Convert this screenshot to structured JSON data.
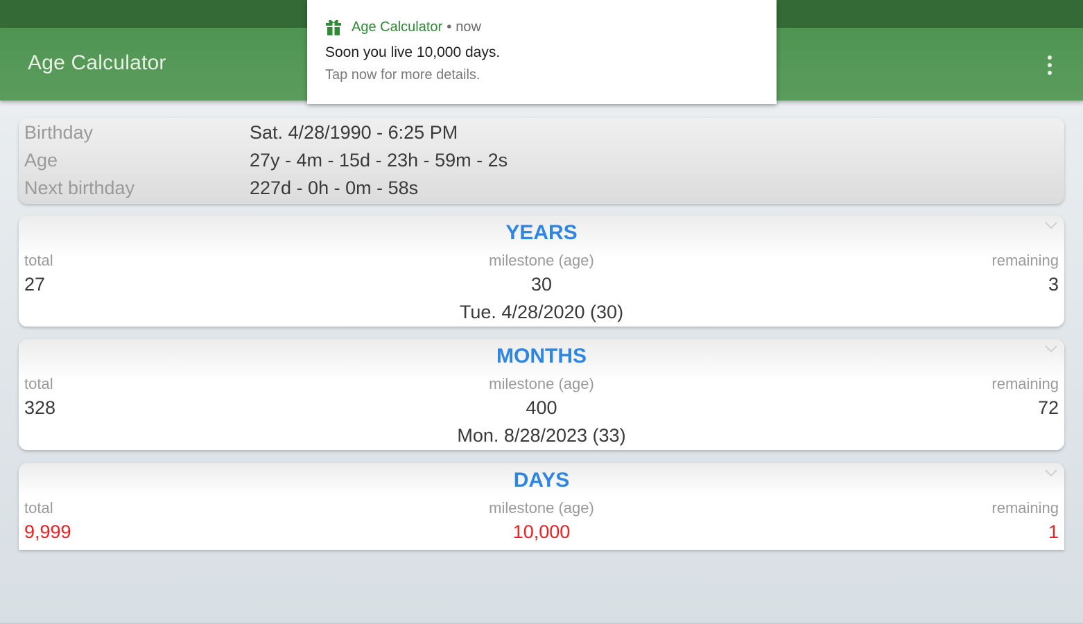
{
  "notification": {
    "app_name": "Age Calculator",
    "separator": "•",
    "time": "now",
    "title": "Soon you live 10,000 days.",
    "text": "Tap now for more details."
  },
  "app_bar": {
    "title": "Age Calculator",
    "menu_icon": "more-vert-icon"
  },
  "summary": {
    "birthday_label": "Birthday",
    "birthday_value": "Sat. 4/28/1990 - 6:25 PM",
    "age_label": "Age",
    "age_value": "27y - 4m - 15d - 23h - 59m - 2s",
    "next_birthday_label": "Next birthday",
    "next_birthday_value": "227d - 0h - 0m - 58s"
  },
  "cards": {
    "years": {
      "title": "YEARS",
      "total_label": "total",
      "milestone_label": "milestone (age)",
      "remaining_label": "remaining",
      "total": "27",
      "milestone": "30",
      "remaining": "3",
      "milestone_date": "Tue. 4/28/2020 (30)"
    },
    "months": {
      "title": "MONTHS",
      "total_label": "total",
      "milestone_label": "milestone (age)",
      "remaining_label": "remaining",
      "total": "328",
      "milestone": "400",
      "remaining": "72",
      "milestone_date": "Mon. 8/28/2023 (33)"
    },
    "days": {
      "title": "DAYS",
      "total_label": "total",
      "milestone_label": "milestone (age)",
      "remaining_label": "remaining",
      "total": "9,999",
      "milestone": "10,000",
      "remaining": "1"
    }
  },
  "colors": {
    "status_bar": "#336a35",
    "app_bar": "#5b9c5d",
    "title_blue": "#2f86e0",
    "highlight_red": "#f01f1f"
  }
}
